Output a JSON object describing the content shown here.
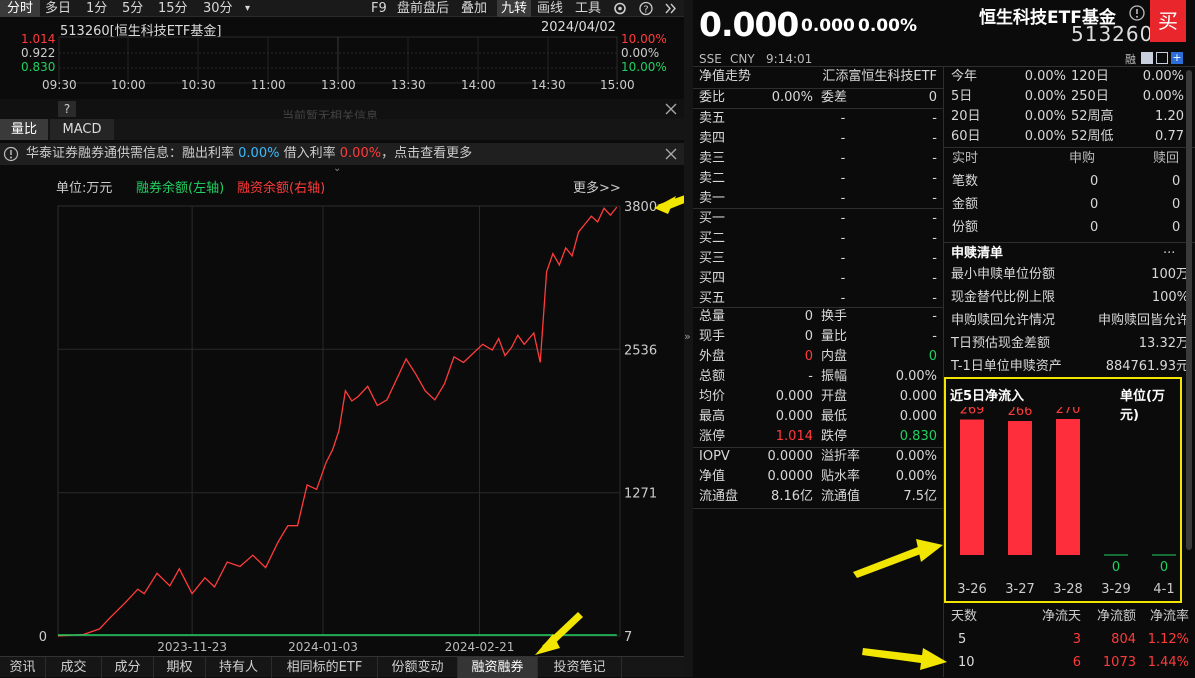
{
  "toolbar": {
    "items": [
      "分时",
      "多日",
      "1分",
      "5分",
      "15分",
      "30分",
      "▾"
    ],
    "right": [
      "F9",
      "盘前盘后",
      "叠加",
      "九转",
      "画线",
      "工具"
    ]
  },
  "intraday": {
    "code_name": "513260[恒生科技ETF基金]",
    "date": "2024/04/02",
    "y_left": [
      "1.014",
      "0.922",
      "0.830"
    ],
    "y_right": [
      "10.00%",
      "0.00%",
      "10.00%"
    ],
    "x": [
      "09:30",
      "10:00",
      "10:30",
      "11:00",
      "13:00",
      "13:30",
      "14:00",
      "14:30",
      "15:00"
    ]
  },
  "mini_strip": {
    "question": "?",
    "faded_text": "当前暂无相关信息"
  },
  "indicator_tabs": [
    "量比",
    "MACD"
  ],
  "margin_notice": {
    "prefix": "华泰证券融券通供需信息：融出利率",
    "rate1": "0.00%",
    "mid": "借入利率",
    "rate2": "0.00%",
    "suffix": "，点击查看更多"
  },
  "chart_header": {
    "unit": "单位:万元",
    "legend1": "融券余额(左轴)",
    "legend2": "融资余额(右轴)",
    "more": "更多>>"
  },
  "chart_data": {
    "type": "line",
    "series": [
      {
        "name": "融资余额(右轴)",
        "color": "#ff3b3b",
        "axis": "right",
        "points": [
          [
            "2023-10-12",
            7
          ],
          [
            "2023-10-20",
            20
          ],
          [
            "2023-10-25",
            70
          ],
          [
            "2023-10-28",
            160
          ],
          [
            "2023-11-02",
            300
          ],
          [
            "2023-11-06",
            420
          ],
          [
            "2023-11-08",
            380
          ],
          [
            "2023-11-12",
            560
          ],
          [
            "2023-11-16",
            450
          ],
          [
            "2023-11-19",
            600
          ],
          [
            "2023-11-23",
            380
          ],
          [
            "2023-11-27",
            520
          ],
          [
            "2023-11-30",
            440
          ],
          [
            "2023-12-04",
            660
          ],
          [
            "2023-12-08",
            620
          ],
          [
            "2023-12-12",
            720
          ],
          [
            "2023-12-16",
            610
          ],
          [
            "2023-12-20",
            840
          ],
          [
            "2023-12-23",
            980
          ],
          [
            "2023-12-26",
            980
          ],
          [
            "2023-12-29",
            1340
          ],
          [
            "2024-01-01",
            1300
          ],
          [
            "2024-01-04",
            1540
          ],
          [
            "2024-01-06",
            1650
          ],
          [
            "2024-01-08",
            1820
          ],
          [
            "2024-01-10",
            2170
          ],
          [
            "2024-01-12",
            2080
          ],
          [
            "2024-01-14",
            2120
          ],
          [
            "2024-01-17",
            2210
          ],
          [
            "2024-01-20",
            2040
          ],
          [
            "2024-01-23",
            2090
          ],
          [
            "2024-01-26",
            2270
          ],
          [
            "2024-01-29",
            2450
          ],
          [
            "2024-02-01",
            2320
          ],
          [
            "2024-02-04",
            2170
          ],
          [
            "2024-02-07",
            2090
          ],
          [
            "2024-02-10",
            2230
          ],
          [
            "2024-02-13",
            2470
          ],
          [
            "2024-02-16",
            2420
          ],
          [
            "2024-02-19",
            2500
          ],
          [
            "2024-02-22",
            2580
          ],
          [
            "2024-02-25",
            2530
          ],
          [
            "2024-02-27",
            2630
          ],
          [
            "2024-02-29",
            2480
          ],
          [
            "2024-03-02",
            2550
          ],
          [
            "2024-03-04",
            2660
          ],
          [
            "2024-03-06",
            2580
          ],
          [
            "2024-03-09",
            2680
          ],
          [
            "2024-03-11",
            2420
          ],
          [
            "2024-03-13",
            3220
          ],
          [
            "2024-03-15",
            3380
          ],
          [
            "2024-03-17",
            3280
          ],
          [
            "2024-03-19",
            3430
          ],
          [
            "2024-03-21",
            3360
          ],
          [
            "2024-03-23",
            3570
          ],
          [
            "2024-03-25",
            3640
          ],
          [
            "2024-03-27",
            3710
          ],
          [
            "2024-03-29",
            3660
          ],
          [
            "2024-03-31",
            3780
          ],
          [
            "2024-04-02",
            3720
          ],
          [
            "2024-04-04",
            3790
          ]
        ]
      },
      {
        "name": "融券余额(左轴)",
        "color": "#20d060",
        "axis": "left",
        "points": [
          [
            "2023-10-12",
            0
          ],
          [
            "2024-04-04",
            0
          ]
        ]
      }
    ],
    "x_ticks": [
      "2023-11-23",
      "2024-01-03",
      "2024-02-21"
    ],
    "y_left_ticks": [
      0
    ],
    "y_right_ticks": [
      3800,
      2536,
      1271,
      7
    ],
    "x_range": [
      "2023-10-12",
      "2024-04-05"
    ],
    "y_right_range": [
      7,
      3800
    ]
  },
  "bottom_tabs": [
    "资讯",
    "成交",
    "成分",
    "期权",
    "持有人",
    "相同标的ETF",
    "份额变动",
    "融资融券",
    "投资笔记"
  ],
  "quote": {
    "price": "0.000",
    "change": "0.000",
    "pct": "0.00%",
    "name": "恒生科技ETF基金",
    "code": "513260",
    "exchange": "SSE",
    "currency": "CNY",
    "time": "9:14:01",
    "buy_label": "买",
    "small_tag": "融"
  },
  "nav": {
    "label": "净值走势",
    "value": "汇添富恒生科技ETF"
  },
  "commission": {
    "l1": "委比",
    "v1": "0.00%",
    "l2": "委差",
    "v2": "0"
  },
  "asks": [
    {
      "label": "卖五",
      "price": "-",
      "vol": "-"
    },
    {
      "label": "卖四",
      "price": "-",
      "vol": "-"
    },
    {
      "label": "卖三",
      "price": "-",
      "vol": "-"
    },
    {
      "label": "卖二",
      "price": "-",
      "vol": "-"
    },
    {
      "label": "卖一",
      "price": "-",
      "vol": "-"
    }
  ],
  "bids": [
    {
      "label": "买一",
      "price": "-",
      "vol": "-"
    },
    {
      "label": "买二",
      "price": "-",
      "vol": "-"
    },
    {
      "label": "买三",
      "price": "-",
      "vol": "-"
    },
    {
      "label": "买四",
      "price": "-",
      "vol": "-"
    },
    {
      "label": "买五",
      "price": "-",
      "vol": "-"
    }
  ],
  "stats": [
    [
      "总量",
      "0",
      "换手",
      "-"
    ],
    [
      "现手",
      "0",
      "量比",
      "-"
    ],
    [
      "外盘",
      "0",
      "内盘",
      "0"
    ],
    [
      "总额",
      "-",
      "振幅",
      "0.00%"
    ],
    [
      "均价",
      "0.000",
      "开盘",
      "0.000"
    ],
    [
      "最高",
      "0.000",
      "最低",
      "0.000"
    ],
    [
      "涨停",
      "1.014",
      "跌停",
      "0.830"
    ]
  ],
  "stats2": [
    [
      "IOPV",
      "0.0000",
      "溢折率",
      "0.00%"
    ],
    [
      "净值",
      "0.0000",
      "贴水率",
      "0.00%"
    ],
    [
      "流通盘",
      "8.16亿",
      "流通值",
      "7.5亿"
    ]
  ],
  "periods": [
    [
      "今年",
      "0.00%",
      "120日",
      "0.00%"
    ],
    [
      "5日",
      "0.00%",
      "250日",
      "0.00%"
    ],
    [
      "20日",
      "0.00%",
      "52周高",
      "1.20"
    ],
    [
      "60日",
      "0.00%",
      "52周低",
      "0.77"
    ]
  ],
  "realtime": {
    "headers": [
      "实时",
      "申购",
      "赎回"
    ],
    "rows": [
      [
        "笔数",
        "0",
        "0"
      ],
      [
        "金额",
        "0",
        "0"
      ],
      [
        "份额",
        "0",
        "0"
      ]
    ]
  },
  "redemption": {
    "title": "申赎清单",
    "more": "···",
    "rows": [
      [
        "最小申赎单位份额",
        "100万"
      ],
      [
        "现金替代比例上限",
        "100%"
      ],
      [
        "申购赎回允许情况",
        "申购赎回皆允许"
      ],
      [
        "T日预估现金差额",
        "13.32万"
      ],
      [
        "T-1日单位申赎资产",
        "884761.93元"
      ]
    ]
  },
  "netflow": {
    "title": "近5日净流入",
    "unit": "单位(万元)",
    "dates": [
      "3-26",
      "3-27",
      "3-28",
      "3-29",
      "4-1"
    ],
    "values": [
      269,
      266,
      270,
      0,
      0
    ],
    "labels": [
      "269",
      "266",
      "270",
      "0",
      "0"
    ]
  },
  "flow_table": {
    "headers": [
      "天数",
      "净流天",
      "净流额",
      "净流率"
    ],
    "rows": [
      [
        "5",
        "3",
        "804",
        "1.12%"
      ],
      [
        "10",
        "6",
        "1073",
        "1.44%"
      ]
    ]
  },
  "colors": {
    "up": "#ff3b3b",
    "down": "#20d060",
    "highlight": "#f2e600",
    "bg": "#0b0b0b"
  }
}
